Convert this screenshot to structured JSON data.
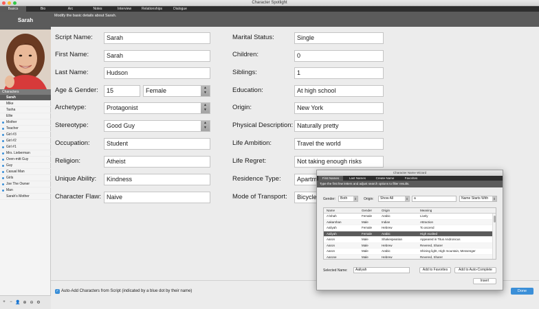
{
  "window": {
    "title": "Character Spotlight"
  },
  "tabs": [
    "Basics",
    "Bio",
    "Arc",
    "Notes",
    "Interview",
    "Relationships",
    "Dialogue"
  ],
  "sidebar": {
    "character_name": "Sarah",
    "list_header": "Characters",
    "characters": [
      {
        "name": "Sarah",
        "dot": false,
        "selected": true
      },
      {
        "name": "Mike",
        "dot": false
      },
      {
        "name": "Tasha",
        "dot": false
      },
      {
        "name": "Ellie",
        "dot": false
      },
      {
        "name": "Mother",
        "dot": true
      },
      {
        "name": "Teacher",
        "dot": true
      },
      {
        "name": "Girl #3",
        "dot": true
      },
      {
        "name": "Girl #2",
        "dot": true
      },
      {
        "name": "Girl #1",
        "dot": true
      },
      {
        "name": "Mrs. Lieberman",
        "dot": true
      },
      {
        "name": "Oven-mitt Guy",
        "dot": true
      },
      {
        "name": "Guy",
        "dot": true
      },
      {
        "name": "Casual Man",
        "dot": true
      },
      {
        "name": "Girls",
        "dot": true
      },
      {
        "name": "Joe The Owner",
        "dot": true
      },
      {
        "name": "Man",
        "dot": true
      },
      {
        "name": "Sarah's Mother",
        "dot": false
      }
    ],
    "toolbar_icons": [
      "plus-icon",
      "minus-icon",
      "person-icon",
      "zoom-in-icon",
      "zoom-out-icon",
      "gear-icon"
    ]
  },
  "header": {
    "text": "Modify the basic details about Sarah."
  },
  "left_fields": {
    "script_name": {
      "label": "Script Name:",
      "value": "Sarah"
    },
    "first_name": {
      "label": "First Name:",
      "value": "Sarah"
    },
    "last_name": {
      "label": "Last Name:",
      "value": "Hudson"
    },
    "age_gender": {
      "label": "Age & Gender:",
      "age": "15",
      "gender": "Female"
    },
    "archetype": {
      "label": "Archetype:",
      "value": "Protagonist"
    },
    "stereotype": {
      "label": "Stereotype:",
      "value": "Good Guy"
    },
    "occupation": {
      "label": "Occupation:",
      "value": "Student"
    },
    "religion": {
      "label": "Religion:",
      "value": "Atheist"
    },
    "unique_ability": {
      "label": "Unique Ability:",
      "value": "Kindness"
    },
    "character_flaw": {
      "label": "Character Flaw:",
      "value": "Naive"
    }
  },
  "right_fields": {
    "marital_status": {
      "label": "Marital Status:",
      "value": "Single"
    },
    "children": {
      "label": "Children:",
      "value": "0"
    },
    "siblings": {
      "label": "Siblings:",
      "value": "1"
    },
    "education": {
      "label": "Education:",
      "value": "At high school"
    },
    "origin": {
      "label": "Origin:",
      "value": "New York"
    },
    "physical_description": {
      "label": "Physical Description:",
      "value": "Naturally pretty"
    },
    "life_ambition": {
      "label": "Life Ambition:",
      "value": "Travel the world"
    },
    "life_regret": {
      "label": "Life Regret:",
      "value": "Not taking enough risks"
    },
    "residence_type": {
      "label": "Residence Type:",
      "value": "Apartm"
    },
    "mode_of_transport": {
      "label": "Mode of Transport:",
      "value": "Bicycle"
    }
  },
  "footer": {
    "auto_add_label": "Auto-Add Characters from Script (indicated by a blue dot by their name)",
    "done_label": "Done"
  },
  "wizard": {
    "title": "Character Name Wizard",
    "tabs": [
      "First Names",
      "Last Names",
      "Create Name",
      "Favorites"
    ],
    "instructions": "Type the first few letters and adjust search options to filter results.",
    "gender_label": "Gender:",
    "gender_value": "Both",
    "origin_label": "Origin:",
    "origin_value": "Show All",
    "search_value": "a",
    "match_value": "Name Starts With",
    "columns": [
      "Name",
      "Gender",
      "Origin",
      "Meaning"
    ],
    "rows": [
      [
        "A'ishah",
        "Female",
        "Arabic",
        "Lively"
      ],
      [
        "Aakarshan",
        "Male",
        "Indian",
        "Attraction"
      ],
      [
        "Aaliyah",
        "Female",
        "Hebrew",
        "To ascend"
      ],
      [
        "Aaliyah",
        "Female",
        "Arabic",
        "High exalted"
      ],
      [
        "Aaron",
        "Male",
        "Shakespearian",
        "Appeared in Titus Andronicus"
      ],
      [
        "Aaron",
        "Male",
        "Hebrew",
        "Revered, Sharer"
      ],
      [
        "Aaron",
        "Male",
        "Arabic",
        "Shining light, High mountain, Messenger"
      ],
      [
        "Aarone",
        "Male",
        "Hebrew",
        "Revered, Sharer"
      ]
    ],
    "selected_row": 3,
    "selected_name_label": "Selected Name:",
    "selected_name_value": "Aaliyah",
    "add_favorites_label": "Add to Favorites",
    "add_autocomplete_label": "Add to Auto-Complete",
    "insert_label": "Insert"
  }
}
